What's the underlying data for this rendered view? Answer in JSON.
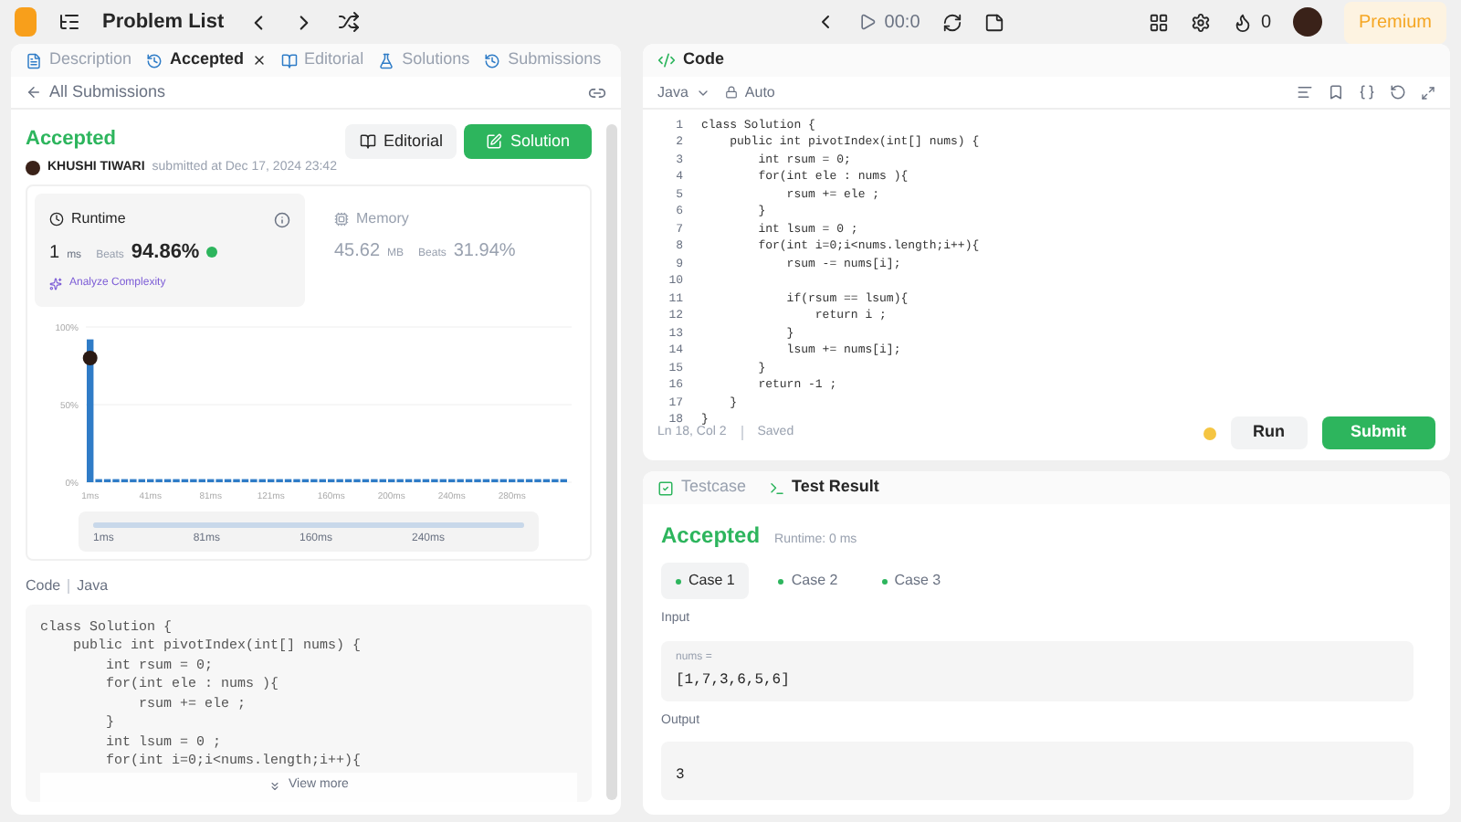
{
  "top_bar": {
    "title": "Problem List",
    "timer": "00:0",
    "streak": "0",
    "premium": "Premium"
  },
  "left_tabs": [
    {
      "label": "Description",
      "selected": false,
      "closable": false
    },
    {
      "label": "Accepted",
      "selected": true,
      "closable": true
    },
    {
      "label": "Editorial",
      "selected": false,
      "closable": false
    },
    {
      "label": "Solutions",
      "selected": false,
      "closable": false
    },
    {
      "label": "Submissions",
      "selected": false,
      "closable": false
    }
  ],
  "back_link": "All Submissions",
  "submission": {
    "status": "Accepted",
    "user": "KHUSHI TIWARI",
    "submitted": "submitted at Dec 17, 2024 23:42",
    "editorial_button": "Editorial",
    "solution_button": "Solution"
  },
  "runtime": {
    "title": "Runtime",
    "value": "1",
    "unit": "ms",
    "beats_label": "Beats",
    "beats": "94.86%",
    "analyze": "Analyze Complexity"
  },
  "memory": {
    "title": "Memory",
    "value": "45.62",
    "unit": "MB",
    "beats_label": "Beats",
    "beats": "31.94%"
  },
  "chart_data": {
    "type": "bar",
    "ylim": [
      0,
      100
    ],
    "yticks": [
      {
        "value": 0,
        "label": "0%"
      },
      {
        "value": 50,
        "label": "50%"
      },
      {
        "value": 100,
        "label": "100%"
      }
    ],
    "categories": [
      "1ms",
      null,
      null,
      null,
      null,
      null,
      null,
      "41ms",
      null,
      null,
      null,
      null,
      null,
      null,
      "81ms",
      null,
      null,
      null,
      null,
      null,
      null,
      "121ms",
      null,
      null,
      null,
      null,
      null,
      null,
      "160ms",
      null,
      null,
      null,
      null,
      null,
      null,
      "200ms",
      null,
      null,
      null,
      null,
      null,
      null,
      "240ms",
      null,
      null,
      null,
      null,
      null,
      null,
      "280ms",
      null,
      null,
      null,
      null,
      null,
      null
    ],
    "values": [
      92,
      2,
      2,
      2,
      2,
      2,
      2,
      2,
      2,
      2,
      2,
      2,
      2,
      2,
      2,
      2,
      2,
      2,
      2,
      2,
      2,
      2,
      2,
      2,
      2,
      2,
      2,
      2,
      2,
      2,
      2,
      2,
      2,
      2,
      2,
      2,
      2,
      2,
      2,
      2,
      2,
      2,
      2,
      2,
      2,
      2,
      2,
      2,
      2,
      2,
      2,
      2,
      2,
      2,
      2,
      2
    ]
  },
  "range_slider": {
    "level": 1,
    "labels": [
      "1ms",
      "81ms",
      "160ms",
      "240ms"
    ]
  },
  "code_header": {
    "label": "Code",
    "language": "Java"
  },
  "code_preview": [
    "class Solution {",
    "    public int pivotIndex(int[] nums) {",
    "        int rsum = 0;",
    "        for(int ele : nums ){",
    "            rsum += ele ;",
    "        }",
    "        int lsum = 0 ;",
    "        for(int i=0;i<nums.length;i++){"
  ],
  "view_more": "View more",
  "editor": {
    "title": "Code",
    "language": "Java",
    "mode": "Auto",
    "status": "Ln 18, Col 2",
    "saved": "Saved",
    "run": "Run",
    "submit": "Submit",
    "lines": [
      {
        "number": "1",
        "text": "class Solution {"
      },
      {
        "number": "2",
        "text": "    public int pivotIndex(int[] nums) {"
      },
      {
        "number": "3",
        "text": "        int rsum = 0;"
      },
      {
        "number": "4",
        "text": "        for(int ele : nums ){"
      },
      {
        "number": "5",
        "text": "            rsum += ele ;"
      },
      {
        "number": "6",
        "text": "        }"
      },
      {
        "number": "7",
        "text": "        int lsum = 0 ;"
      },
      {
        "number": "8",
        "text": "        for(int i=0;i<nums.length;i++){"
      },
      {
        "number": "9",
        "text": "            rsum -= nums[i];"
      },
      {
        "number": "10"
      },
      {
        "number": "11",
        "text": "            if(rsum == lsum){"
      },
      {
        "number": "12",
        "text": "                return i ;"
      },
      {
        "number": "13",
        "text": "            }"
      },
      {
        "number": "14",
        "text": "            lsum += nums[i];"
      },
      {
        "number": "15",
        "text": "        }"
      },
      {
        "number": "16",
        "text": "        return -1 ;"
      },
      {
        "number": "17",
        "text": "    }"
      },
      {
        "number": "18",
        "text": "}"
      }
    ]
  },
  "result_tabs": [
    {
      "label": "Testcase",
      "selected": false
    },
    {
      "label": "Test Result",
      "selected": true
    }
  ],
  "result": {
    "status": "Accepted",
    "runtime": "Runtime: 0 ms",
    "input_label": "Input",
    "var": "nums =",
    "input": "[1,7,3,6,5,6]",
    "output_label": "Output",
    "output": "3"
  },
  "cases": [
    {
      "label": "Case 1",
      "selected": true
    },
    {
      "label": "Case 2",
      "selected": false
    },
    {
      "label": "Case 3",
      "selected": false
    }
  ]
}
